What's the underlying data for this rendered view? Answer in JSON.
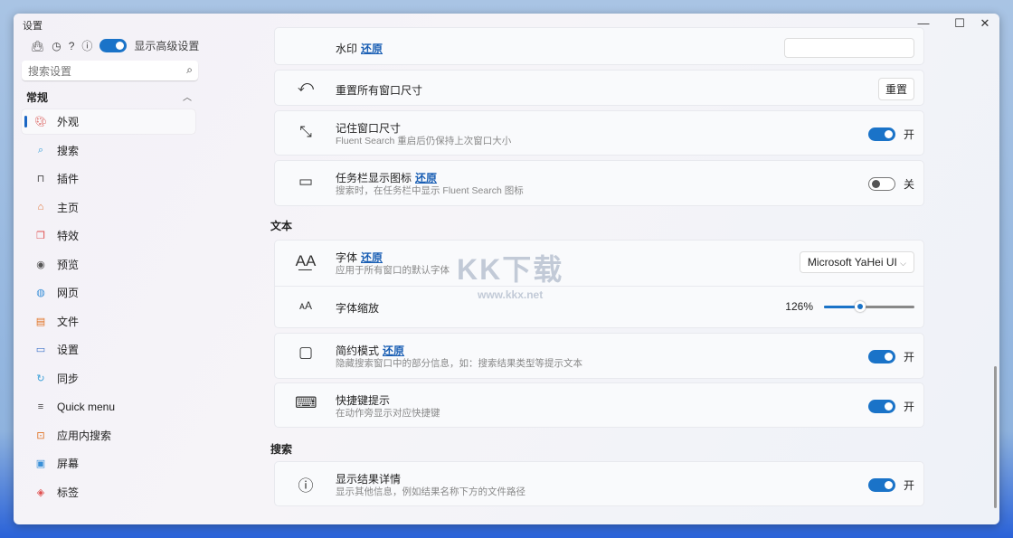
{
  "window": {
    "title": "设置",
    "min": "—",
    "max": "☐",
    "close": "✕"
  },
  "sidebar": {
    "advanced_label": "显示高级设置",
    "search_placeholder": "搜索设置",
    "section": "常规",
    "items": [
      {
        "label": "外观",
        "icon": "palette",
        "color": "#d9534f"
      },
      {
        "label": "搜索",
        "icon": "search",
        "color": "#3aa0d8"
      },
      {
        "label": "插件",
        "icon": "bag",
        "color": "#444"
      },
      {
        "label": "主页",
        "icon": "home",
        "color": "#e07030"
      },
      {
        "label": "特效",
        "icon": "effects",
        "color": "#e05050"
      },
      {
        "label": "预览",
        "icon": "eye",
        "color": "#555"
      },
      {
        "label": "网页",
        "icon": "globe",
        "color": "#3a90d8"
      },
      {
        "label": "文件",
        "icon": "file",
        "color": "#e07020"
      },
      {
        "label": "设置",
        "icon": "laptop",
        "color": "#3a70c8"
      },
      {
        "label": "同步",
        "icon": "sync",
        "color": "#3aa0d8"
      },
      {
        "label": "Quick menu",
        "icon": "menu",
        "color": "#444"
      },
      {
        "label": "应用内搜索",
        "icon": "app-search",
        "color": "#e07020"
      },
      {
        "label": "屏幕",
        "icon": "screen",
        "color": "#3a90d8"
      },
      {
        "label": "标签",
        "icon": "tag",
        "color": "#e05050"
      }
    ]
  },
  "main": {
    "watermark": {
      "title": "水印",
      "reset": "还原"
    },
    "reset_sizes": {
      "title": "重置所有窗口尺寸",
      "button": "重置"
    },
    "remember": {
      "title": "记住窗口尺寸",
      "desc": "Fluent Search 重启后仍保持上次窗口大小",
      "state": "开",
      "on": true
    },
    "taskbar": {
      "title": "任务栏显示图标",
      "reset": "还原",
      "desc": "搜索时，在任务栏中显示 Fluent Search 图标",
      "state": "关",
      "on": false
    },
    "text_header": "文本",
    "font": {
      "title": "字体",
      "reset": "还原",
      "desc": "应用于所有窗口的默认字体",
      "value": "Microsoft YaHei UI"
    },
    "font_scale": {
      "title": "字体缩放",
      "value": "126%",
      "slider_fraction": 0.4
    },
    "compact": {
      "title": "简约模式",
      "reset": "还原",
      "desc": "隐藏搜索窗口中的部分信息，如：搜索结果类型等提示文本",
      "state": "开",
      "on": true
    },
    "shortcut": {
      "title": "快捷键提示",
      "desc": "在动作旁显示对应快捷键",
      "state": "开",
      "on": true
    },
    "search_header": "搜索",
    "details": {
      "title": "显示结果详情",
      "desc": "显示其他信息，例如结果名称下方的文件路径",
      "state": "开",
      "on": true
    }
  },
  "overlay": {
    "logo": "KK下载",
    "url": "www.kkx.net"
  }
}
